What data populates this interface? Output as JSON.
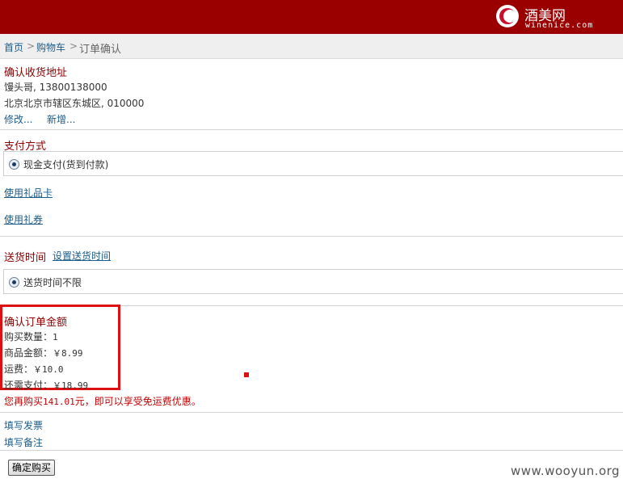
{
  "header": {
    "logo_cn": "酒美网",
    "logo_en": "winenice.com",
    "brand_color": "#9b0000"
  },
  "breadcrumb": {
    "home": "首页",
    "cart": "购物车",
    "current": "订单确认",
    "separator": ">"
  },
  "address": {
    "title": "确认收货地址",
    "name_phone": "馒头哥, 13800138000",
    "address_line": "北京北京市辖区东城区, 010000",
    "edit_label": "修改...",
    "add_label": "新增..."
  },
  "payment": {
    "title": "支付方式",
    "option_label": "现金支付(货到付款)",
    "gift_card_link": "使用礼品卡",
    "coupon_link": "使用礼券"
  },
  "delivery": {
    "title": "送货时间",
    "set_link": "设置送货时间",
    "option_label": "送货时间不限"
  },
  "order_summary": {
    "title": "确认订单金额",
    "qty_label": "购买数量：",
    "qty_value": "1",
    "goods_label": "商品金额：",
    "goods_value": "￥8.99",
    "shipping_label": "运费：",
    "shipping_value": "￥10.0",
    "due_label": "还需支付：",
    "due_value": "￥18.99",
    "free_shipping_prefix": "您再购买",
    "free_shipping_amount": "141.01",
    "free_shipping_suffix": "元，即可以享受免运费优惠。"
  },
  "extras": {
    "invoice_link": "填写发票",
    "remark_link": "填写备注"
  },
  "actions": {
    "confirm_button": "确定购买"
  },
  "watermark": "www.wooyun.org",
  "colors": {
    "title_red": "#8b0000",
    "link_blue": "#1a5c8a",
    "alert_red": "#c00000",
    "highlight_red": "#dd1111"
  }
}
